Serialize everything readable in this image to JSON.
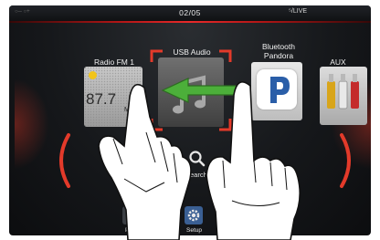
{
  "header": {
    "page_indicator": "02/05",
    "status_right": "LIVE"
  },
  "tiles": [
    {
      "label": "Radio FM 1",
      "frequency": "87.7",
      "unit": "MHz"
    },
    {
      "label": "USB Audio"
    },
    {
      "label_line1": "Bluetooth",
      "label_line2": "Pandora"
    },
    {
      "label": "AUX"
    }
  ],
  "menu": {
    "search_label": "Search",
    "phone_label": "Phone",
    "setup_label": "Setup"
  },
  "colors": {
    "accent_red": "#e33a2a",
    "swipe_arrow": "#4caf3a",
    "pandora_blue": "#2a5ea8"
  },
  "icons": {
    "swipe": "left-arrow-icon",
    "search": "magnifier-icon",
    "setup": "gear-icon",
    "radio": "play-circle-icon",
    "usb": "music-note-icon"
  }
}
